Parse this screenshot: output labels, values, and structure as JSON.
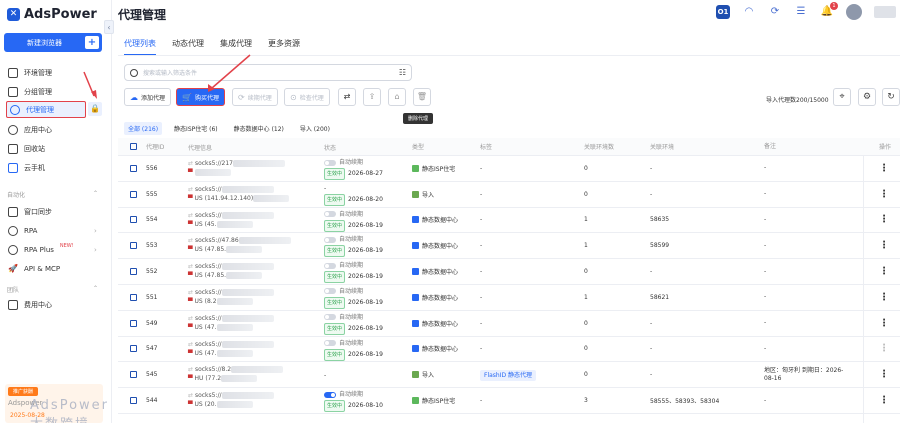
{
  "app": {
    "name": "AdsPower"
  },
  "sidebar": {
    "new_browser": "新建浏览器",
    "items": [
      {
        "label": "环境管理"
      },
      {
        "label": "分组管理"
      },
      {
        "label": "代理管理"
      },
      {
        "label": "应用中心"
      },
      {
        "label": "回收站"
      },
      {
        "label": "云手机"
      }
    ],
    "section_automation": "自动化",
    "auto_items": [
      {
        "label": "窗口同步"
      },
      {
        "label": "RPA"
      },
      {
        "label": "RPA Plus",
        "badge": "NEW!"
      },
      {
        "label": "API & MCP"
      }
    ],
    "section_team": "团队",
    "team_items": [
      {
        "label": "费用中心"
      }
    ],
    "promo": {
      "tag": "推广获酬",
      "brand": "Adspower",
      "date": "2025-08-28"
    },
    "watermark": "AdsPower 大数跨境"
  },
  "header": {
    "title": "代理管理"
  },
  "tabs": [
    {
      "label": "代理列表",
      "active": true
    },
    {
      "label": "动态代理"
    },
    {
      "label": "集成代理"
    },
    {
      "label": "更多资源"
    }
  ],
  "search": {
    "placeholder": "搜索或输入筛选条件"
  },
  "toolbar": {
    "add": "添加代理",
    "buy": "购买代理",
    "renew": "续期代理",
    "check": "检查代理",
    "tooltip": "删除代理",
    "ip_count": "导入代理数200/15000"
  },
  "filters": [
    {
      "label": "全部 (216)",
      "active": true
    },
    {
      "label": "静态ISP住宅 (6)"
    },
    {
      "label": "静态数据中心 (12)"
    },
    {
      "label": "导入 (200)"
    }
  ],
  "table": {
    "headers": [
      "代理ID",
      "代理信息",
      "状态",
      "类型",
      "标签",
      "关联环境数",
      "关联环境",
      "备注",
      "操作"
    ],
    "rows": [
      {
        "id": "556",
        "line1": "socks5://217",
        "line2": "",
        "toggle": "自动续期",
        "status": "生效中",
        "date": "2026-08-27",
        "type": "静态ISP住宅",
        "tcolor": "#5cb85c",
        "tag": "-",
        "env": "0",
        "envid": "-",
        "remark": "-"
      },
      {
        "id": "555",
        "line1": "socks5://",
        "line2": "US (141.94.12.140)",
        "toggle": "-",
        "status": "生效中",
        "date": "2026-08-20",
        "type": "导入",
        "tcolor": "#6aa84f",
        "tag": "-",
        "env": "0",
        "envid": "-",
        "remark": "-"
      },
      {
        "id": "554",
        "line1": "socks5://",
        "line2": "US (45.",
        "toggle": "自动续期",
        "status": "生效中",
        "date": "2026-08-19",
        "type": "静态数据中心",
        "tcolor": "#2768f4",
        "tag": "-",
        "env": "1",
        "envid": "58635",
        "remark": "-"
      },
      {
        "id": "553",
        "line1": "socks5://47.86",
        "line2": "US (47.85.",
        "toggle": "自动续期",
        "status": "生效中",
        "date": "2026-08-19",
        "type": "静态数据中心",
        "tcolor": "#2768f4",
        "tag": "-",
        "env": "1",
        "envid": "58599",
        "remark": "-"
      },
      {
        "id": "552",
        "line1": "socks5://",
        "line2": "US (47.85.",
        "toggle": "自动续期",
        "status": "生效中",
        "date": "2026-08-19",
        "type": "静态数据中心",
        "tcolor": "#2768f4",
        "tag": "-",
        "env": "0",
        "envid": "-",
        "remark": "-"
      },
      {
        "id": "551",
        "line1": "socks5://",
        "line2": "US (8.2",
        "toggle": "自动续期",
        "status": "生效中",
        "date": "2026-08-19",
        "type": "静态数据中心",
        "tcolor": "#2768f4",
        "tag": "-",
        "env": "1",
        "envid": "58621",
        "remark": "-"
      },
      {
        "id": "549",
        "line1": "socks5://",
        "line2": "US (47.",
        "toggle": "自动续期",
        "status": "生效中",
        "date": "2026-08-19",
        "type": "静态数据中心",
        "tcolor": "#2768f4",
        "tag": "-",
        "env": "0",
        "envid": "-",
        "remark": "-"
      },
      {
        "id": "547",
        "line1": "socks5://",
        "line2": "US (47.",
        "toggle": "自动续期",
        "status": "生效中",
        "date": "2026-08-19",
        "type": "静态数据中心",
        "tcolor": "#2768f4",
        "tag": "-",
        "env": "0",
        "envid": "-",
        "remark": "-",
        "dim": true
      },
      {
        "id": "545",
        "line1": "socks5://8.2",
        "line2": "HU (77.2",
        "toggle": "",
        "status": "",
        "date": "",
        "nostatus": true,
        "type": "导入",
        "tcolor": "#6aa84f",
        "tag": "FlashID 静态代理",
        "env": "0",
        "envid": "-",
        "remark": "地区：匈牙利 到期日：2026-08-16"
      },
      {
        "id": "544",
        "line1": "socks5://",
        "line2": "US (20.",
        "toggle": "自动续期",
        "toggle_on": true,
        "status": "生效中",
        "date": "2026-08-10",
        "type": "静态ISP住宅",
        "tcolor": "#5cb85c",
        "tag": "-",
        "env": "3",
        "envid": "58555、58393、58304",
        "remark": "-"
      }
    ]
  }
}
